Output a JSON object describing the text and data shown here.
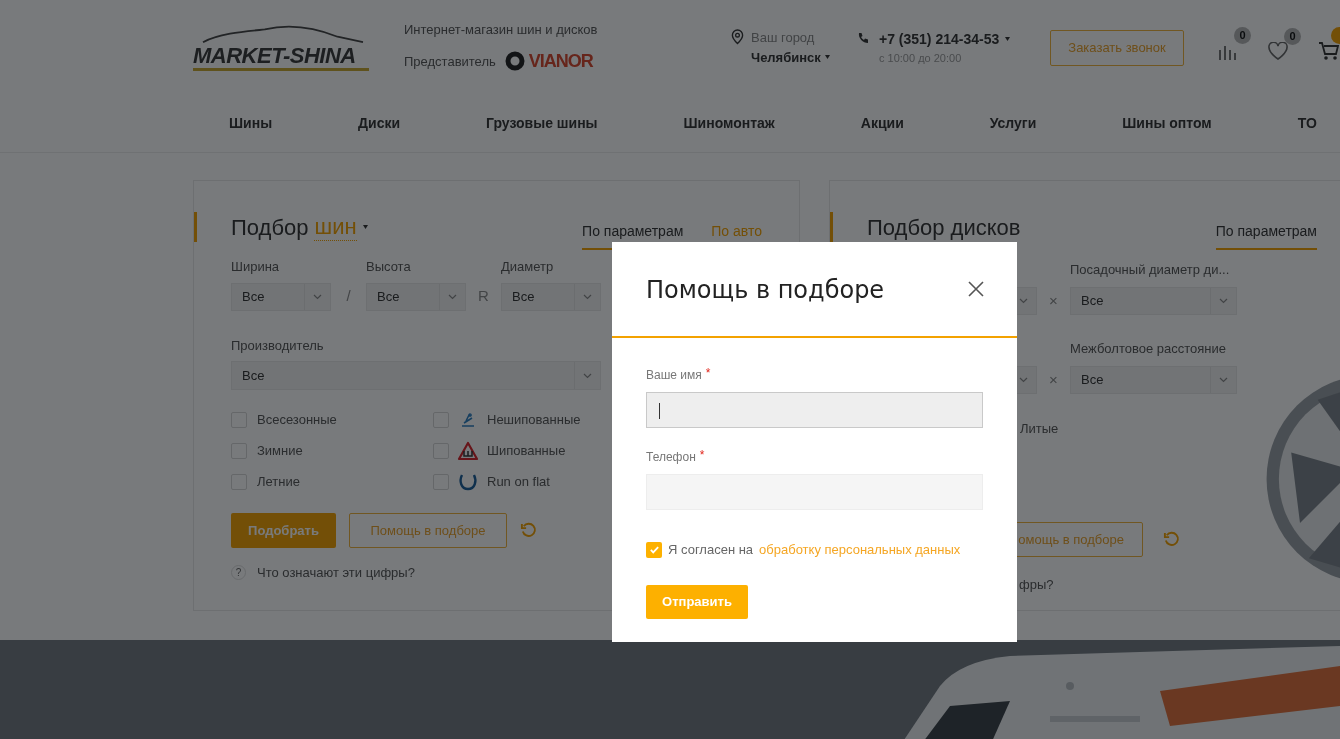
{
  "header": {
    "logo_text": "MARKET-SHINA",
    "tagline": "Интернет-магазин шин и дисков",
    "representative_label": "Представитель",
    "partner_logo_text": "VIANOR",
    "city_label": "Ваш город",
    "city": "Челябинск",
    "phone": "+7 (351) 214-34-53",
    "hours": "с 10:00 до 20:00",
    "callback_button": "Заказать звонок",
    "compare_count": "0",
    "favorites_count": "0"
  },
  "nav": [
    {
      "label": "Шины"
    },
    {
      "label": "Диски"
    },
    {
      "label": "Грузовые шины"
    },
    {
      "label": "Шиномонтаж"
    },
    {
      "label": "Акции"
    },
    {
      "label": "Услуги"
    },
    {
      "label": "Шины оптом"
    },
    {
      "label": "ТО"
    }
  ],
  "tire_picker": {
    "title": "Подбор",
    "title_accent": "шин",
    "tabs": [
      {
        "label": "По параметрам",
        "selected": true
      },
      {
        "label": "По авто",
        "selected": false
      }
    ],
    "size_fields": [
      {
        "label": "Ширина",
        "value": "Все"
      },
      {
        "label": "Высота",
        "value": "Все"
      },
      {
        "label": "Диаметр",
        "value": "Все"
      }
    ],
    "separators": [
      "/",
      "R"
    ],
    "manufacturer": {
      "label": "Производитель",
      "value": "Все"
    },
    "season_options": [
      {
        "label": "Всесезонные",
        "checked": false
      },
      {
        "label": "Зимние",
        "checked": false
      },
      {
        "label": "Летние",
        "checked": false
      }
    ],
    "tread_options": [
      {
        "label": "Нешипованные",
        "checked": false,
        "kind": "studless"
      },
      {
        "label": "Шипованные",
        "checked": false,
        "kind": "studded"
      },
      {
        "label": "Run on flat",
        "checked": false,
        "kind": "runflat"
      }
    ],
    "submit_button": "Подобрать",
    "help_button": "Помощь в подборе",
    "help_icon": "?",
    "help_link": "Что означают эти цифры?"
  },
  "disc_picker": {
    "title": "Подбор дисков",
    "tabs": [
      {
        "label": "По параметрам",
        "selected": true
      }
    ],
    "fields": [
      {
        "label": "Посадочный диаметр ди...",
        "value": "Все"
      },
      {
        "label": "Межболтовое расстояние",
        "value": "Все"
      }
    ],
    "separators": [
      "×",
      "×"
    ],
    "cast_option": "Литые",
    "help_button": "омощь в подборе",
    "help_link": "фры?"
  },
  "modal": {
    "title": "Помощь в подборе",
    "fields": [
      {
        "label": "Ваше имя",
        "required_mark": "*",
        "focused": true
      },
      {
        "label": "Телефон",
        "required_mark": "*",
        "focused": false
      }
    ],
    "consent": {
      "checked": true,
      "text": "Я согласен на",
      "link": "обработку персональных данных"
    },
    "submit_button": "Отправить"
  }
}
